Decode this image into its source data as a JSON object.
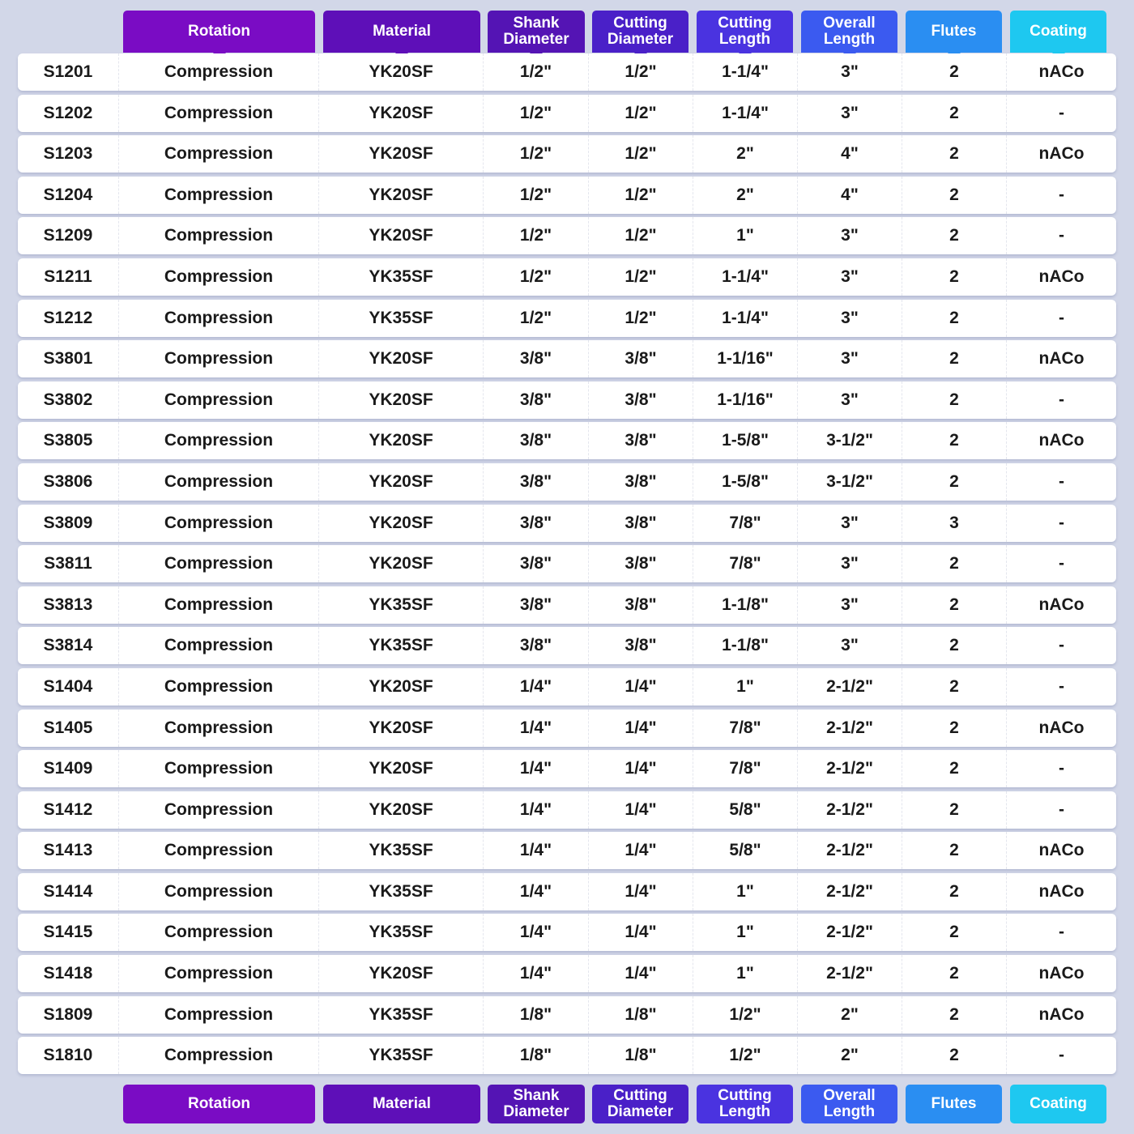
{
  "headers": [
    {
      "key": "rotation",
      "label": "Rotation",
      "color": "#7a0cc4"
    },
    {
      "key": "material",
      "label": "Material",
      "color": "#5e0fb8"
    },
    {
      "key": "shank",
      "label": "Shank Diameter",
      "color": "#5414b4"
    },
    {
      "key": "cutting_diameter",
      "label": "Cutting Diameter",
      "color": "#4a20c8"
    },
    {
      "key": "cutting_length",
      "label": "Cutting Length",
      "color": "#4a33e0"
    },
    {
      "key": "overall_length",
      "label": "Overall Length",
      "color": "#3b5af0"
    },
    {
      "key": "flutes",
      "label": "Flutes",
      "color": "#2a8ef2"
    },
    {
      "key": "coating",
      "label": "Coating",
      "color": "#1ec8f0"
    }
  ],
  "rows": [
    [
      "S1201",
      "Compression",
      "YK20SF",
      "1/2\"",
      "1/2\"",
      "1-1/4\"",
      "3\"",
      "2",
      "nACo"
    ],
    [
      "S1202",
      "Compression",
      "YK20SF",
      "1/2\"",
      "1/2\"",
      "1-1/4\"",
      "3\"",
      "2",
      "-"
    ],
    [
      "S1203",
      "Compression",
      "YK20SF",
      "1/2\"",
      "1/2\"",
      "2\"",
      "4\"",
      "2",
      "nACo"
    ],
    [
      "S1204",
      "Compression",
      "YK20SF",
      "1/2\"",
      "1/2\"",
      "2\"",
      "4\"",
      "2",
      "-"
    ],
    [
      "S1209",
      "Compression",
      "YK20SF",
      "1/2\"",
      "1/2\"",
      "1\"",
      "3\"",
      "2",
      "-"
    ],
    [
      "S1211",
      "Compression",
      "YK35SF",
      "1/2\"",
      "1/2\"",
      "1-1/4\"",
      "3\"",
      "2",
      "nACo"
    ],
    [
      "S1212",
      "Compression",
      "YK35SF",
      "1/2\"",
      "1/2\"",
      "1-1/4\"",
      "3\"",
      "2",
      "-"
    ],
    [
      "S3801",
      "Compression",
      "YK20SF",
      "3/8\"",
      "3/8\"",
      "1-1/16\"",
      "3\"",
      "2",
      "nACo"
    ],
    [
      "S3802",
      "Compression",
      "YK20SF",
      "3/8\"",
      "3/8\"",
      "1-1/16\"",
      "3\"",
      "2",
      "-"
    ],
    [
      "S3805",
      "Compression",
      "YK20SF",
      "3/8\"",
      "3/8\"",
      "1-5/8\"",
      "3-1/2\"",
      "2",
      "nACo"
    ],
    [
      "S3806",
      "Compression",
      "YK20SF",
      "3/8\"",
      "3/8\"",
      "1-5/8\"",
      "3-1/2\"",
      "2",
      "-"
    ],
    [
      "S3809",
      "Compression",
      "YK20SF",
      "3/8\"",
      "3/8\"",
      "7/8\"",
      "3\"",
      "3",
      "-"
    ],
    [
      "S3811",
      "Compression",
      "YK20SF",
      "3/8\"",
      "3/8\"",
      "7/8\"",
      "3\"",
      "2",
      "-"
    ],
    [
      "S3813",
      "Compression",
      "YK35SF",
      "3/8\"",
      "3/8\"",
      "1-1/8\"",
      "3\"",
      "2",
      "nACo"
    ],
    [
      "S3814",
      "Compression",
      "YK35SF",
      "3/8\"",
      "3/8\"",
      "1-1/8\"",
      "3\"",
      "2",
      "-"
    ],
    [
      "S1404",
      "Compression",
      "YK20SF",
      "1/4\"",
      "1/4\"",
      "1\"",
      "2-1/2\"",
      "2",
      "-"
    ],
    [
      "S1405",
      "Compression",
      "YK20SF",
      "1/4\"",
      "1/4\"",
      "7/8\"",
      "2-1/2\"",
      "2",
      "nACo"
    ],
    [
      "S1409",
      "Compression",
      "YK20SF",
      "1/4\"",
      "1/4\"",
      "7/8\"",
      "2-1/2\"",
      "2",
      "-"
    ],
    [
      "S1412",
      "Compression",
      "YK20SF",
      "1/4\"",
      "1/4\"",
      "5/8\"",
      "2-1/2\"",
      "2",
      "-"
    ],
    [
      "S1413",
      "Compression",
      "YK35SF",
      "1/4\"",
      "1/4\"",
      "5/8\"",
      "2-1/2\"",
      "2",
      "nACo"
    ],
    [
      "S1414",
      "Compression",
      "YK35SF",
      "1/4\"",
      "1/4\"",
      "1\"",
      "2-1/2\"",
      "2",
      "nACo"
    ],
    [
      "S1415",
      "Compression",
      "YK35SF",
      "1/4\"",
      "1/4\"",
      "1\"",
      "2-1/2\"",
      "2",
      "-"
    ],
    [
      "S1418",
      "Compression",
      "YK20SF",
      "1/4\"",
      "1/4\"",
      "1\"",
      "2-1/2\"",
      "2",
      "nACo"
    ],
    [
      "S1809",
      "Compression",
      "YK35SF",
      "1/8\"",
      "1/8\"",
      "1/2\"",
      "2\"",
      "2",
      "nACo"
    ],
    [
      "S1810",
      "Compression",
      "YK35SF",
      "1/8\"",
      "1/8\"",
      "1/2\"",
      "2\"",
      "2",
      "-"
    ]
  ]
}
